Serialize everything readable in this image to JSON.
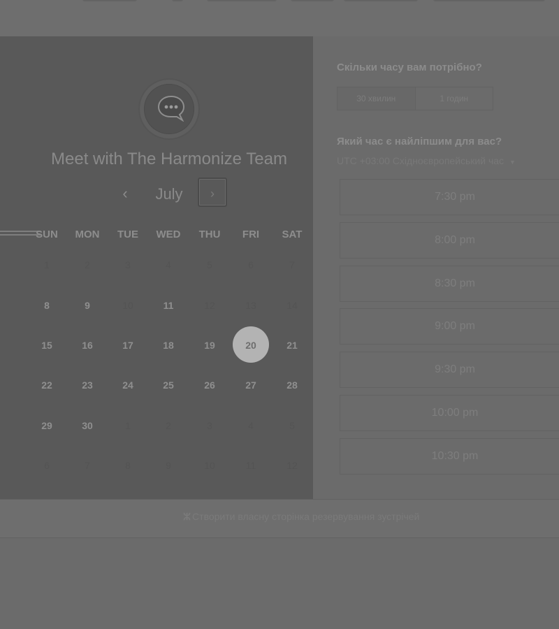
{
  "scheduler": {
    "title": "Meet with The Harmonize Team",
    "month": "July",
    "prev_icon": "chevron-left-icon",
    "next_icon": "chevron-right-icon",
    "weekdays": [
      "SUN",
      "MON",
      "TUE",
      "WED",
      "THU",
      "FRI",
      "SAT"
    ],
    "weeks": [
      [
        {
          "d": "1",
          "s": "inactive"
        },
        {
          "d": "2",
          "s": "inactive"
        },
        {
          "d": "3",
          "s": "inactive"
        },
        {
          "d": "4",
          "s": "inactive"
        },
        {
          "d": "5",
          "s": "inactive"
        },
        {
          "d": "6",
          "s": "inactive"
        },
        {
          "d": "7",
          "s": "inactive"
        }
      ],
      [
        {
          "d": "8",
          "s": "active"
        },
        {
          "d": "9",
          "s": "active"
        },
        {
          "d": "10",
          "s": "inactive"
        },
        {
          "d": "11",
          "s": "active"
        },
        {
          "d": "12",
          "s": "inactive"
        },
        {
          "d": "13",
          "s": "inactive"
        },
        {
          "d": "14",
          "s": "inactive"
        }
      ],
      [
        {
          "d": "15",
          "s": "active"
        },
        {
          "d": "16",
          "s": "active"
        },
        {
          "d": "17",
          "s": "active"
        },
        {
          "d": "18",
          "s": "active"
        },
        {
          "d": "19",
          "s": "active"
        },
        {
          "d": "20",
          "s": "selected"
        },
        {
          "d": "21",
          "s": "active"
        }
      ],
      [
        {
          "d": "22",
          "s": "active"
        },
        {
          "d": "23",
          "s": "active"
        },
        {
          "d": "24",
          "s": "active"
        },
        {
          "d": "25",
          "s": "active"
        },
        {
          "d": "26",
          "s": "active"
        },
        {
          "d": "27",
          "s": "active"
        },
        {
          "d": "28",
          "s": "active"
        }
      ],
      [
        {
          "d": "29",
          "s": "active"
        },
        {
          "d": "30",
          "s": "active"
        },
        {
          "d": "1",
          "s": "outside"
        },
        {
          "d": "2",
          "s": "outside"
        },
        {
          "d": "3",
          "s": "outside"
        },
        {
          "d": "4",
          "s": "outside"
        },
        {
          "d": "5",
          "s": "outside"
        }
      ],
      [
        {
          "d": "6",
          "s": "outside"
        },
        {
          "d": "7",
          "s": "outside"
        },
        {
          "d": "8",
          "s": "outside"
        },
        {
          "d": "9",
          "s": "outside"
        },
        {
          "d": "10",
          "s": "outside"
        },
        {
          "d": "11",
          "s": "outside"
        },
        {
          "d": "12",
          "s": "outside"
        }
      ]
    ]
  },
  "booking": {
    "duration_heading": "Скільки часу вам потрібно?",
    "duration_options": [
      "30 хвилин",
      "1 годин"
    ],
    "selected_duration": "30 хвилин",
    "time_heading": "Який час є найліпшим для вас?",
    "timezone": "UTC +03:00 Східноєвропейський час",
    "timezone_icon": "caret-down-icon",
    "slots": [
      "7:30 pm",
      "8:00 pm",
      "8:30 pm",
      "9:00 pm",
      "9:30 pm",
      "10:00 pm",
      "10:30 pm"
    ]
  },
  "footer": {
    "link": "Створити власну сторінка резервування зустрічей",
    "icon": "hubspot-sprocket-icon"
  },
  "colors": {
    "overlay_bg": "#6b6b6b",
    "calendar_panel": "#595959",
    "selected_day": "#b3b3b3"
  }
}
